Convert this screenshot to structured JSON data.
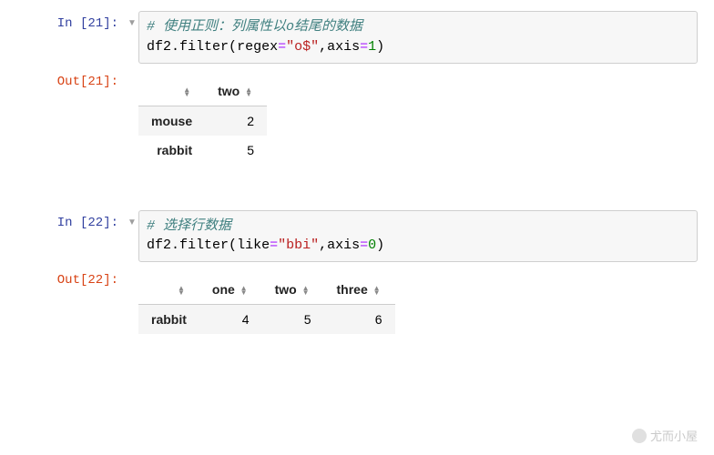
{
  "cells": [
    {
      "in_prompt": "In [21]:",
      "out_prompt": "Out[21]:",
      "code_comment": "# 使用正则：列属性以o结尾的数据",
      "code_line": {
        "obj": "df2",
        "method": "filter",
        "kw1": "regex",
        "val1": "\"o$\"",
        "kw2": "axis",
        "val2": "1"
      },
      "table": {
        "columns": [
          "two"
        ],
        "rows": [
          {
            "index": "mouse",
            "cells": [
              "2"
            ]
          },
          {
            "index": "rabbit",
            "cells": [
              "5"
            ]
          }
        ]
      }
    },
    {
      "in_prompt": "In [22]:",
      "out_prompt": "Out[22]:",
      "code_comment": "# 选择行数据",
      "code_line": {
        "obj": "df2",
        "method": "filter",
        "kw1": "like",
        "val1": "\"bbi\"",
        "kw2": "axis",
        "val2": "0"
      },
      "table": {
        "columns": [
          "one",
          "two",
          "three"
        ],
        "rows": [
          {
            "index": "rabbit",
            "cells": [
              "4",
              "5",
              "6"
            ]
          }
        ]
      }
    }
  ],
  "watermark": "尤而小屋",
  "chart_data": [
    {
      "type": "table",
      "title": "df2.filter(regex=\"o$\", axis=1)",
      "columns": [
        "",
        "two"
      ],
      "rows": [
        [
          "mouse",
          2
        ],
        [
          "rabbit",
          5
        ]
      ]
    },
    {
      "type": "table",
      "title": "df2.filter(like=\"bbi\", axis=0)",
      "columns": [
        "",
        "one",
        "two",
        "three"
      ],
      "rows": [
        [
          "rabbit",
          4,
          5,
          6
        ]
      ]
    }
  ]
}
